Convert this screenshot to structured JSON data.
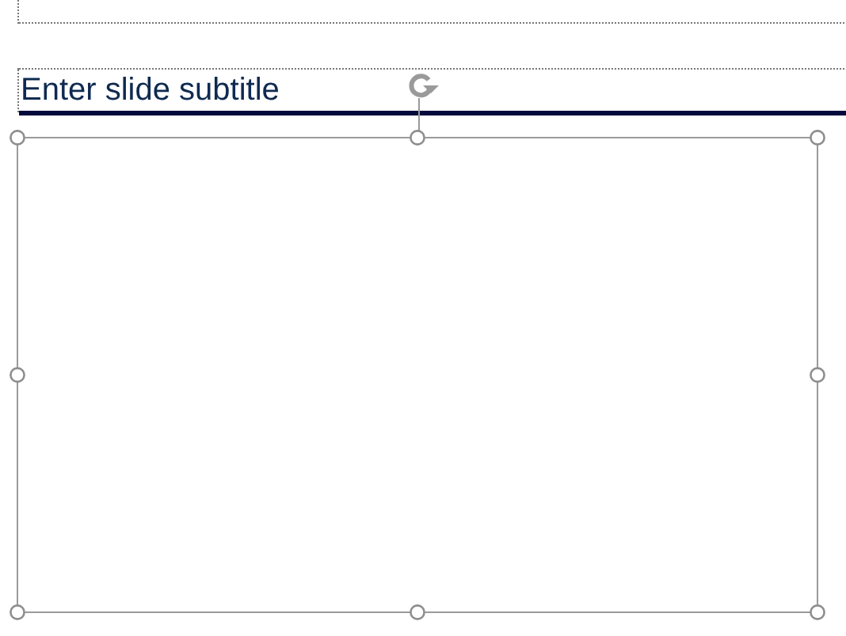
{
  "subtitle_placeholder": {
    "placeholder": "Enter slide subtitle"
  },
  "shape": {
    "selected": true
  }
}
